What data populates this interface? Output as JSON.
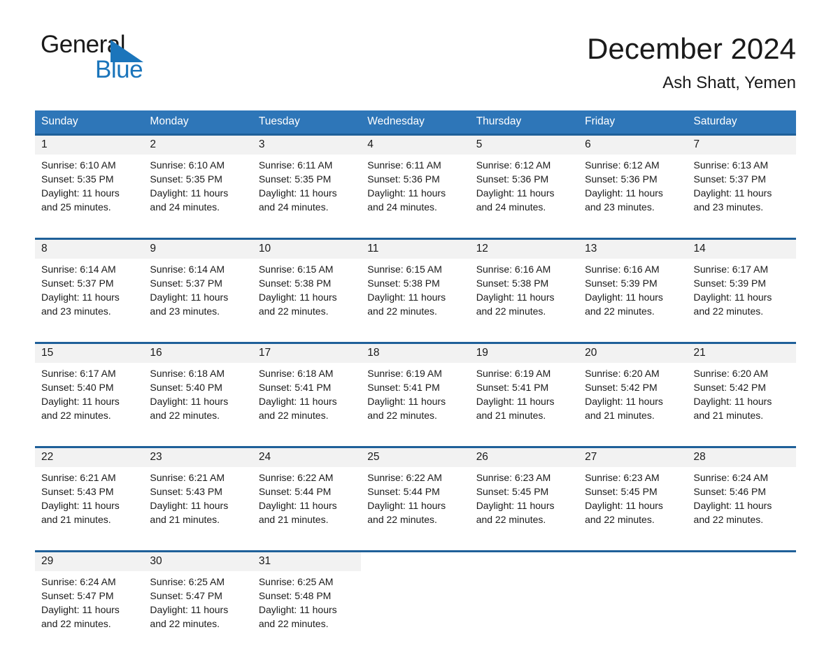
{
  "logo": {
    "word1": "General",
    "word2": "Blue",
    "triangle_color": "#1b75bb"
  },
  "header": {
    "title": "December 2024",
    "subtitle": "Ash Shatt, Yemen"
  },
  "theme": {
    "header_blue": "#2e76b8",
    "rule_blue": "#1f6099",
    "daynum_band": "#f2f2f2"
  },
  "weekdays": [
    "Sunday",
    "Monday",
    "Tuesday",
    "Wednesday",
    "Thursday",
    "Friday",
    "Saturday"
  ],
  "weeks": [
    [
      {
        "day": "1",
        "sunrise": "Sunrise: 6:10 AM",
        "sunset": "Sunset: 5:35 PM",
        "daylight": "Daylight: 11 hours and 25 minutes."
      },
      {
        "day": "2",
        "sunrise": "Sunrise: 6:10 AM",
        "sunset": "Sunset: 5:35 PM",
        "daylight": "Daylight: 11 hours and 24 minutes."
      },
      {
        "day": "3",
        "sunrise": "Sunrise: 6:11 AM",
        "sunset": "Sunset: 5:35 PM",
        "daylight": "Daylight: 11 hours and 24 minutes."
      },
      {
        "day": "4",
        "sunrise": "Sunrise: 6:11 AM",
        "sunset": "Sunset: 5:36 PM",
        "daylight": "Daylight: 11 hours and 24 minutes."
      },
      {
        "day": "5",
        "sunrise": "Sunrise: 6:12 AM",
        "sunset": "Sunset: 5:36 PM",
        "daylight": "Daylight: 11 hours and 24 minutes."
      },
      {
        "day": "6",
        "sunrise": "Sunrise: 6:12 AM",
        "sunset": "Sunset: 5:36 PM",
        "daylight": "Daylight: 11 hours and 23 minutes."
      },
      {
        "day": "7",
        "sunrise": "Sunrise: 6:13 AM",
        "sunset": "Sunset: 5:37 PM",
        "daylight": "Daylight: 11 hours and 23 minutes."
      }
    ],
    [
      {
        "day": "8",
        "sunrise": "Sunrise: 6:14 AM",
        "sunset": "Sunset: 5:37 PM",
        "daylight": "Daylight: 11 hours and 23 minutes."
      },
      {
        "day": "9",
        "sunrise": "Sunrise: 6:14 AM",
        "sunset": "Sunset: 5:37 PM",
        "daylight": "Daylight: 11 hours and 23 minutes."
      },
      {
        "day": "10",
        "sunrise": "Sunrise: 6:15 AM",
        "sunset": "Sunset: 5:38 PM",
        "daylight": "Daylight: 11 hours and 22 minutes."
      },
      {
        "day": "11",
        "sunrise": "Sunrise: 6:15 AM",
        "sunset": "Sunset: 5:38 PM",
        "daylight": "Daylight: 11 hours and 22 minutes."
      },
      {
        "day": "12",
        "sunrise": "Sunrise: 6:16 AM",
        "sunset": "Sunset: 5:38 PM",
        "daylight": "Daylight: 11 hours and 22 minutes."
      },
      {
        "day": "13",
        "sunrise": "Sunrise: 6:16 AM",
        "sunset": "Sunset: 5:39 PM",
        "daylight": "Daylight: 11 hours and 22 minutes."
      },
      {
        "day": "14",
        "sunrise": "Sunrise: 6:17 AM",
        "sunset": "Sunset: 5:39 PM",
        "daylight": "Daylight: 11 hours and 22 minutes."
      }
    ],
    [
      {
        "day": "15",
        "sunrise": "Sunrise: 6:17 AM",
        "sunset": "Sunset: 5:40 PM",
        "daylight": "Daylight: 11 hours and 22 minutes."
      },
      {
        "day": "16",
        "sunrise": "Sunrise: 6:18 AM",
        "sunset": "Sunset: 5:40 PM",
        "daylight": "Daylight: 11 hours and 22 minutes."
      },
      {
        "day": "17",
        "sunrise": "Sunrise: 6:18 AM",
        "sunset": "Sunset: 5:41 PM",
        "daylight": "Daylight: 11 hours and 22 minutes."
      },
      {
        "day": "18",
        "sunrise": "Sunrise: 6:19 AM",
        "sunset": "Sunset: 5:41 PM",
        "daylight": "Daylight: 11 hours and 22 minutes."
      },
      {
        "day": "19",
        "sunrise": "Sunrise: 6:19 AM",
        "sunset": "Sunset: 5:41 PM",
        "daylight": "Daylight: 11 hours and 21 minutes."
      },
      {
        "day": "20",
        "sunrise": "Sunrise: 6:20 AM",
        "sunset": "Sunset: 5:42 PM",
        "daylight": "Daylight: 11 hours and 21 minutes."
      },
      {
        "day": "21",
        "sunrise": "Sunrise: 6:20 AM",
        "sunset": "Sunset: 5:42 PM",
        "daylight": "Daylight: 11 hours and 21 minutes."
      }
    ],
    [
      {
        "day": "22",
        "sunrise": "Sunrise: 6:21 AM",
        "sunset": "Sunset: 5:43 PM",
        "daylight": "Daylight: 11 hours and 21 minutes."
      },
      {
        "day": "23",
        "sunrise": "Sunrise: 6:21 AM",
        "sunset": "Sunset: 5:43 PM",
        "daylight": "Daylight: 11 hours and 21 minutes."
      },
      {
        "day": "24",
        "sunrise": "Sunrise: 6:22 AM",
        "sunset": "Sunset: 5:44 PM",
        "daylight": "Daylight: 11 hours and 21 minutes."
      },
      {
        "day": "25",
        "sunrise": "Sunrise: 6:22 AM",
        "sunset": "Sunset: 5:44 PM",
        "daylight": "Daylight: 11 hours and 22 minutes."
      },
      {
        "day": "26",
        "sunrise": "Sunrise: 6:23 AM",
        "sunset": "Sunset: 5:45 PM",
        "daylight": "Daylight: 11 hours and 22 minutes."
      },
      {
        "day": "27",
        "sunrise": "Sunrise: 6:23 AM",
        "sunset": "Sunset: 5:45 PM",
        "daylight": "Daylight: 11 hours and 22 minutes."
      },
      {
        "day": "28",
        "sunrise": "Sunrise: 6:24 AM",
        "sunset": "Sunset: 5:46 PM",
        "daylight": "Daylight: 11 hours and 22 minutes."
      }
    ],
    [
      {
        "day": "29",
        "sunrise": "Sunrise: 6:24 AM",
        "sunset": "Sunset: 5:47 PM",
        "daylight": "Daylight: 11 hours and 22 minutes."
      },
      {
        "day": "30",
        "sunrise": "Sunrise: 6:25 AM",
        "sunset": "Sunset: 5:47 PM",
        "daylight": "Daylight: 11 hours and 22 minutes."
      },
      {
        "day": "31",
        "sunrise": "Sunrise: 6:25 AM",
        "sunset": "Sunset: 5:48 PM",
        "daylight": "Daylight: 11 hours and 22 minutes."
      },
      null,
      null,
      null,
      null
    ]
  ]
}
